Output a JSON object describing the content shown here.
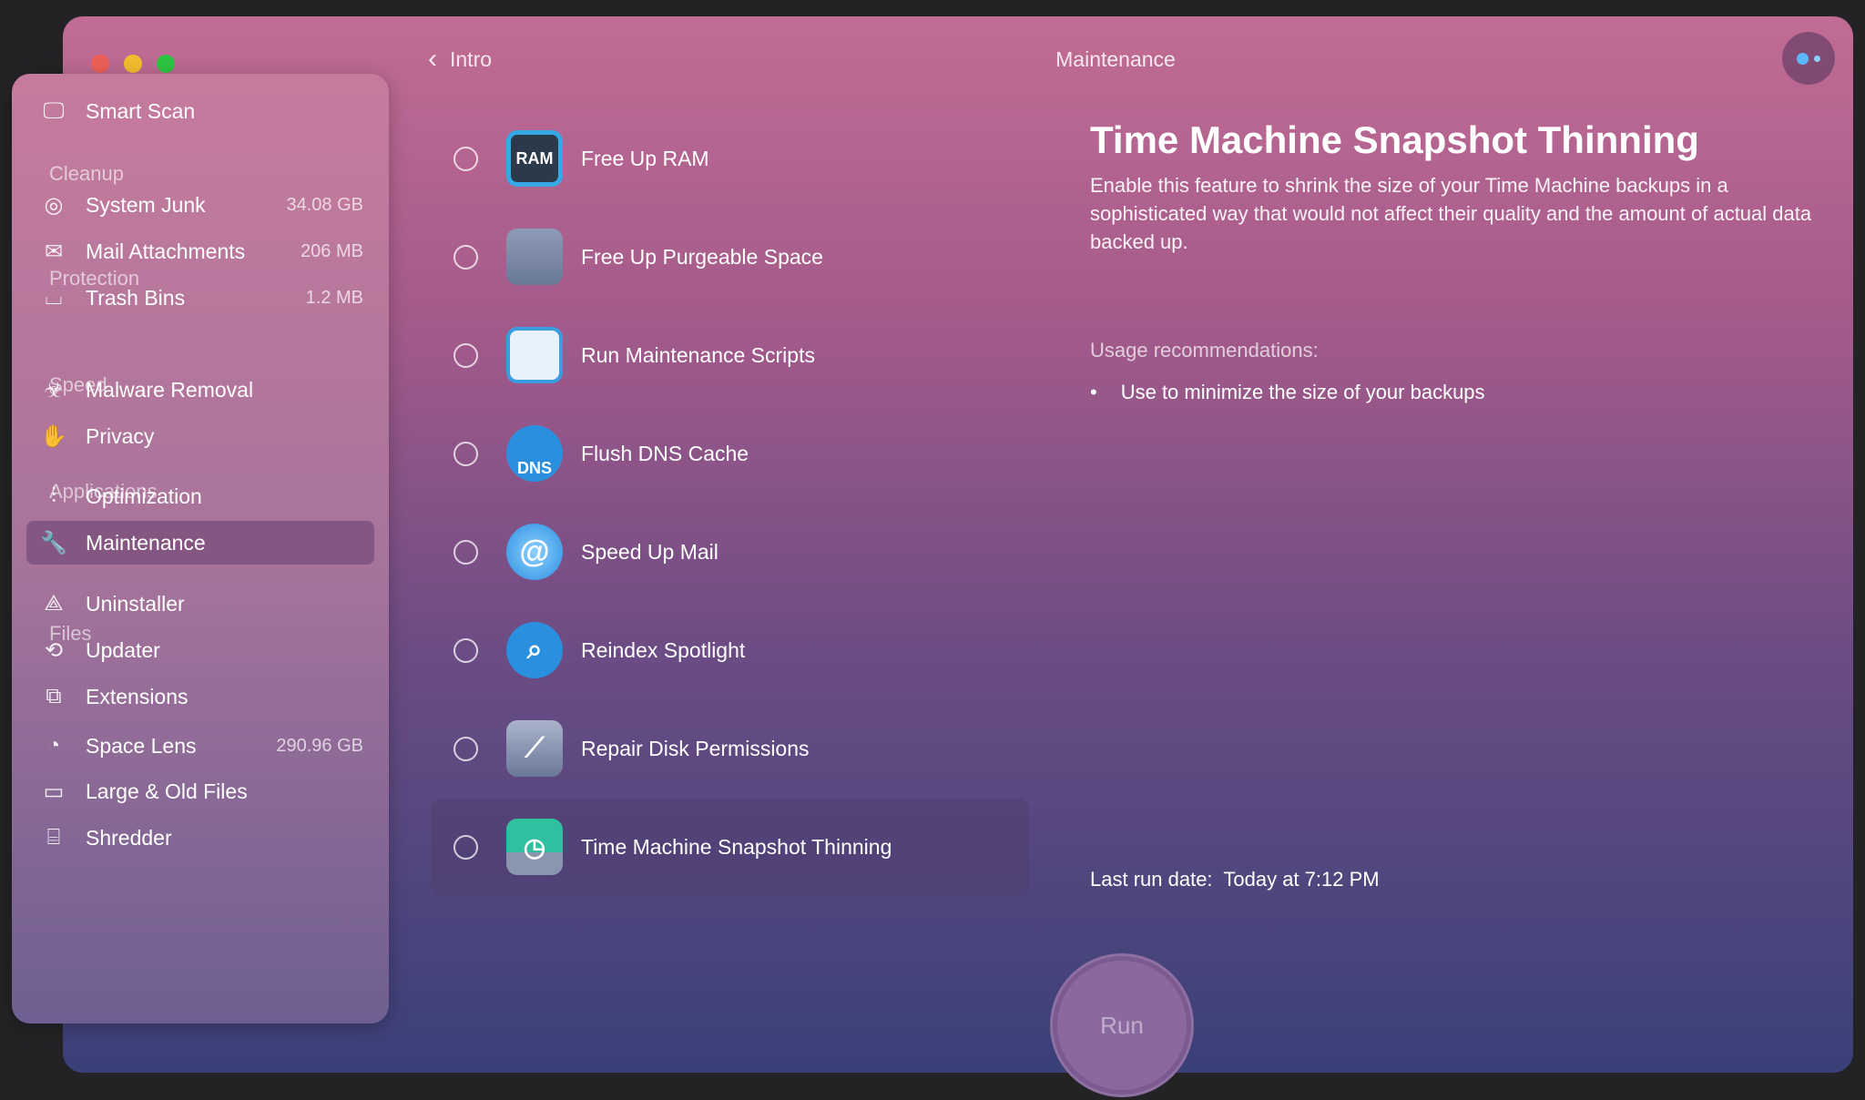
{
  "header": {
    "back_label": "Intro",
    "title": "Maintenance"
  },
  "sidebar": {
    "smart_scan": "Smart Scan",
    "sections": [
      {
        "title": "Cleanup",
        "items": [
          {
            "label": "System Junk",
            "value": "34.08 GB",
            "icon": "system-junk-icon"
          },
          {
            "label": "Mail Attachments",
            "value": "206 MB",
            "icon": "mail-icon"
          },
          {
            "label": "Trash Bins",
            "value": "1.2 MB",
            "icon": "trash-icon"
          }
        ]
      },
      {
        "title": "Protection",
        "items": [
          {
            "label": "Malware Removal",
            "icon": "biohazard-icon"
          },
          {
            "label": "Privacy",
            "icon": "hand-icon"
          }
        ]
      },
      {
        "title": "Speed",
        "items": [
          {
            "label": "Optimization",
            "icon": "sliders-icon"
          },
          {
            "label": "Maintenance",
            "icon": "wrench-icon",
            "active": true
          }
        ]
      },
      {
        "title": "Applications",
        "items": [
          {
            "label": "Uninstaller",
            "icon": "uninstaller-icon"
          },
          {
            "label": "Updater",
            "icon": "updater-icon"
          },
          {
            "label": "Extensions",
            "icon": "extensions-icon"
          }
        ]
      },
      {
        "title": "Files",
        "items": [
          {
            "label": "Space Lens",
            "value": "290.96 GB",
            "icon": "space-lens-icon"
          },
          {
            "label": "Large & Old Files",
            "icon": "folder-icon"
          },
          {
            "label": "Shredder",
            "icon": "shredder-icon"
          }
        ]
      }
    ]
  },
  "tasks": [
    {
      "label": "Free Up RAM",
      "icon": "ram-icon",
      "icon_text": "RAM"
    },
    {
      "label": "Free Up Purgeable Space",
      "icon": "disk-icon"
    },
    {
      "label": "Run Maintenance Scripts",
      "icon": "clipboard-icon"
    },
    {
      "label": "Flush DNS Cache",
      "icon": "dns-icon",
      "icon_text": "DNS"
    },
    {
      "label": "Speed Up Mail",
      "icon": "mail-speed-icon"
    },
    {
      "label": "Reindex Spotlight",
      "icon": "spotlight-icon"
    },
    {
      "label": "Repair Disk Permissions",
      "icon": "disk-repair-icon"
    },
    {
      "label": "Time Machine Snapshot Thinning",
      "icon": "time-machine-icon",
      "selected": true
    }
  ],
  "detail": {
    "title": "Time Machine Snapshot Thinning",
    "description": "Enable this feature to shrink the size of your Time Machine backups in a sophisticated way that would not affect their quality and the amount of actual data backed up.",
    "usage_title": "Usage recommendations:",
    "usage_items": [
      "Use to minimize the size of your backups"
    ],
    "last_run_label": "Last run date:",
    "last_run_value": "Today at 7:12 PM"
  },
  "run_label": "Run"
}
